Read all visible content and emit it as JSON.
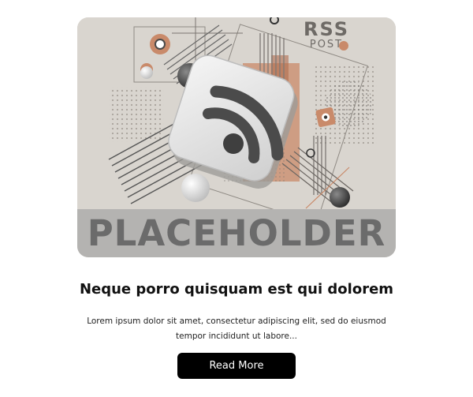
{
  "card": {
    "image": {
      "badge_line1": "RSS",
      "badge_line2": "POST",
      "placeholder_label": "PLACEHOLDER",
      "icon": "rss-feed-icon"
    },
    "title": "Neque porro quisquam est qui dolorem",
    "excerpt": "Lorem ipsum dolor sit amet, consectetur adipiscing elit, sed do eiusmod tempor incididunt ut labore...",
    "button_label": "Read More"
  },
  "colors": {
    "button_bg": "#000000",
    "button_text": "#ffffff",
    "title": "#111111",
    "accent": "#c98a6a"
  }
}
